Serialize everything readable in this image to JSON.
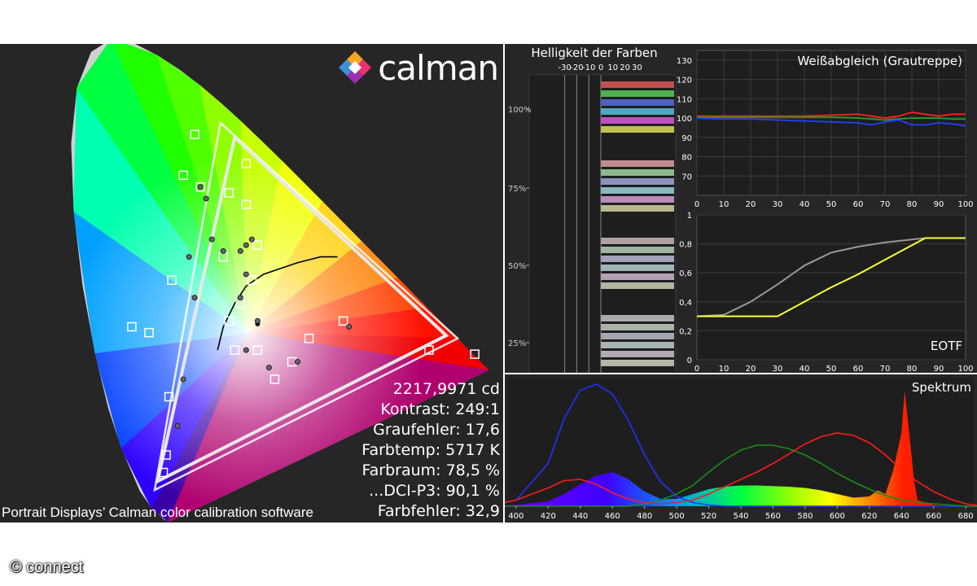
{
  "logo": {
    "text": "calman"
  },
  "stats": {
    "luminance": "2217,9971 cd",
    "contrast": "Kontrast: 249:1",
    "gray_error": "Graufehler: 17,6",
    "color_temp": "Farbtemp: 5717 K",
    "color_space": "Farbraum: 78,5 %",
    "dci_p3": "...DCI-P3: 90,1 %",
    "color_error": "Farbfehler: 32,9"
  },
  "caption": "Portrait Displays’ Calman color calibration software",
  "copyright": "© connect",
  "colors": {
    "panel_bg": "#262626",
    "red": "#ff1a1a",
    "green": "#1a8c1a",
    "blue": "#1a33ff",
    "yellow": "#ffff33",
    "gray": "#999999"
  },
  "chart_data": [
    {
      "type": "scatter",
      "name": "cie",
      "title": "",
      "gamut_target": {
        "red": [
          0.68,
          0.32
        ],
        "green": [
          0.265,
          0.69
        ],
        "blue": [
          0.15,
          0.06
        ]
      },
      "gamut_measured": {
        "red": [
          0.66,
          0.325
        ],
        "green": [
          0.29,
          0.665
        ],
        "blue": [
          0.155,
          0.075
        ]
      },
      "targets": [
        [
          0.71,
          0.293
        ],
        [
          0.63,
          0.3
        ],
        [
          0.48,
          0.35
        ],
        [
          0.42,
          0.32
        ],
        [
          0.39,
          0.28
        ],
        [
          0.36,
          0.25
        ],
        [
          0.33,
          0.3
        ],
        [
          0.29,
          0.3
        ],
        [
          0.28,
          0.35
        ],
        [
          0.3,
          0.38
        ],
        [
          0.32,
          0.42
        ],
        [
          0.33,
          0.48
        ],
        [
          0.31,
          0.55
        ],
        [
          0.31,
          0.62
        ],
        [
          0.23,
          0.58
        ],
        [
          0.22,
          0.67
        ],
        [
          0.2,
          0.6
        ],
        [
          0.18,
          0.42
        ],
        [
          0.175,
          0.22
        ],
        [
          0.17,
          0.12
        ],
        [
          0.165,
          0.09
        ],
        [
          0.27,
          0.46
        ],
        [
          0.28,
          0.57
        ],
        [
          0.14,
          0.33
        ],
        [
          0.11,
          0.34
        ]
      ],
      "measured": [
        [
          0.49,
          0.34
        ],
        [
          0.4,
          0.28
        ],
        [
          0.33,
          0.35
        ],
        [
          0.35,
          0.27
        ],
        [
          0.31,
          0.3
        ],
        [
          0.3,
          0.39
        ],
        [
          0.31,
          0.43
        ],
        [
          0.31,
          0.48
        ],
        [
          0.32,
          0.49
        ],
        [
          0.27,
          0.47
        ],
        [
          0.25,
          0.49
        ],
        [
          0.3,
          0.47
        ],
        [
          0.22,
          0.39
        ],
        [
          0.2,
          0.25
        ],
        [
          0.19,
          0.17
        ],
        [
          0.21,
          0.46
        ],
        [
          0.24,
          0.56
        ],
        [
          0.23,
          0.58
        ]
      ],
      "planckian_locus": [
        [
          0.26,
          0.3
        ],
        [
          0.27,
          0.34
        ],
        [
          0.29,
          0.38
        ],
        [
          0.31,
          0.41
        ],
        [
          0.34,
          0.43
        ],
        [
          0.37,
          0.44
        ],
        [
          0.4,
          0.45
        ],
        [
          0.44,
          0.46
        ],
        [
          0.47,
          0.46
        ]
      ]
    },
    {
      "type": "bar",
      "name": "brightness",
      "title": "Helligkeit der Farben",
      "xticks": [
        "-30",
        "-20",
        "-10",
        "0",
        "10",
        "20",
        "30"
      ],
      "xlim": [
        -40,
        35
      ],
      "ytick_labels": [
        "100%",
        "75%",
        "50%",
        "25%"
      ],
      "groups": [
        {
          "level": "100%",
          "values": [
            0,
            0,
            0,
            0,
            0,
            0
          ],
          "colors": [
            "#c05050",
            "#50b050",
            "#5060c0",
            "#50a8c0",
            "#c050c0",
            "#c0c050"
          ]
        },
        {
          "level": "75%",
          "values": [
            0,
            0,
            0,
            0,
            0,
            0
          ],
          "colors": [
            "#c08c8c",
            "#8cb88c",
            "#8c94c0",
            "#8cb8c0",
            "#b88cb8",
            "#b8b88c"
          ]
        },
        {
          "level": "50%",
          "values": [
            0,
            0,
            0,
            0,
            0,
            0
          ],
          "colors": [
            "#b0a0a0",
            "#a0b4a0",
            "#a0a4b8",
            "#a0b4b8",
            "#b4a0b4",
            "#b4b4a0"
          ]
        },
        {
          "level": "25%",
          "values": [
            0,
            0,
            0,
            0,
            0,
            0
          ],
          "colors": [
            "#aaaaaa",
            "#a8b4a8",
            "#a4a8b4",
            "#a8b4b4",
            "#b4a8b4",
            "#b4b4a8"
          ]
        }
      ]
    },
    {
      "type": "line",
      "name": "whitebalance",
      "title": "Weißabgleich (Grautreppe)",
      "x": [
        0,
        10,
        20,
        30,
        40,
        50,
        60,
        65,
        70,
        75,
        80,
        85,
        90,
        95,
        100
      ],
      "xlim": [
        0,
        100
      ],
      "ylim": [
        60,
        135
      ],
      "yticks": [
        70,
        80,
        90,
        100,
        110,
        120,
        130
      ],
      "xticks": [
        0,
        10,
        20,
        30,
        40,
        50,
        60,
        70,
        80,
        90,
        100
      ],
      "series": [
        {
          "values": [
            101,
            101,
            101,
            101,
            101,
            101.5,
            102,
            101,
            100,
            101,
            103,
            102,
            101,
            102,
            102
          ],
          "color": "#ff2020"
        },
        {
          "values": [
            100.5,
            100.5,
            100.5,
            100.5,
            100.5,
            100.5,
            100,
            99.5,
            99,
            99.5,
            100,
            100,
            100,
            99.5,
            99.5
          ],
          "color": "#20a020"
        },
        {
          "values": [
            100,
            99.5,
            99.5,
            99,
            98.5,
            98,
            97.5,
            96.5,
            98,
            99,
            96.5,
            96.5,
            97.5,
            97,
            96
          ],
          "color": "#2040ff"
        }
      ]
    },
    {
      "type": "line",
      "name": "eotf",
      "title": "EOTF",
      "x": [
        0,
        10,
        20,
        30,
        40,
        50,
        60,
        70,
        80,
        85,
        90,
        100
      ],
      "xlim": [
        0,
        100
      ],
      "ylim": [
        0,
        1
      ],
      "yticks": [
        "0",
        "0,2",
        "0,4",
        "0,6",
        "0,8",
        "1"
      ],
      "xticks": [
        0,
        10,
        20,
        30,
        40,
        50,
        60,
        70,
        80,
        90,
        100
      ],
      "series": [
        {
          "values": [
            0.3,
            0.31,
            0.4,
            0.52,
            0.65,
            0.74,
            0.78,
            0.81,
            0.83,
            0.84,
            0.84,
            0.84
          ],
          "color": "#999999"
        },
        {
          "values": [
            0.3,
            0.3,
            0.3,
            0.3,
            0.4,
            0.5,
            0.59,
            0.69,
            0.79,
            0.84,
            0.84,
            0.84
          ],
          "color": "#ffff33"
        }
      ]
    },
    {
      "type": "area",
      "name": "spectrum",
      "title": "Spektrum",
      "x": [
        380,
        400,
        420,
        430,
        440,
        450,
        460,
        470,
        480,
        490,
        500,
        510,
        520,
        530,
        540,
        550,
        560,
        570,
        580,
        590,
        600,
        610,
        620,
        625,
        630,
        635,
        640,
        642,
        644,
        646,
        648,
        650,
        660,
        670,
        680,
        690
      ],
      "xlim": [
        395,
        685
      ],
      "ylim": [
        0,
        1
      ],
      "xticks": [
        400,
        420,
        440,
        460,
        480,
        500,
        520,
        540,
        560,
        580,
        600,
        620,
        640,
        660,
        680
      ],
      "measured": [
        0,
        0.01,
        0.04,
        0.1,
        0.18,
        0.25,
        0.28,
        0.22,
        0.12,
        0.06,
        0.06,
        0.1,
        0.14,
        0.16,
        0.17,
        0.17,
        0.165,
        0.16,
        0.15,
        0.13,
        0.1,
        0.07,
        0.08,
        0.13,
        0.1,
        0.3,
        0.6,
        0.95,
        0.7,
        0.45,
        0.2,
        0.05,
        0.01,
        0,
        0,
        0
      ],
      "series": [
        {
          "values": [
            0,
            0.05,
            0.35,
            0.72,
            0.95,
            1.0,
            0.92,
            0.7,
            0.42,
            0.2,
            0.08,
            0.03,
            0.01,
            0,
            0,
            0,
            0,
            0,
            0,
            0,
            0,
            0,
            0,
            0,
            0,
            0,
            0,
            0,
            0,
            0,
            0,
            0,
            0,
            0,
            0,
            0
          ],
          "color": "#2030ff"
        },
        {
          "values": [
            0,
            0,
            0,
            0,
            0,
            0,
            0,
            0,
            0.02,
            0.05,
            0.1,
            0.17,
            0.28,
            0.38,
            0.46,
            0.5,
            0.5,
            0.47,
            0.42,
            0.35,
            0.27,
            0.2,
            0.14,
            0.11,
            0.09,
            0.07,
            0.05,
            0.05,
            0.04,
            0.04,
            0.04,
            0.03,
            0.02,
            0.01,
            0,
            0
          ],
          "color": "#1a8c1a"
        },
        {
          "values": [
            0,
            0.05,
            0.15,
            0.21,
            0.22,
            0.18,
            0.11,
            0.06,
            0.03,
            0.02,
            0.03,
            0.05,
            0.1,
            0.16,
            0.22,
            0.28,
            0.35,
            0.43,
            0.51,
            0.57,
            0.6,
            0.58,
            0.52,
            0.47,
            0.42,
            0.36,
            0.3,
            0.28,
            0.26,
            0.24,
            0.22,
            0.2,
            0.12,
            0.06,
            0.02,
            0
          ],
          "color": "#ff1a1a"
        }
      ]
    }
  ]
}
